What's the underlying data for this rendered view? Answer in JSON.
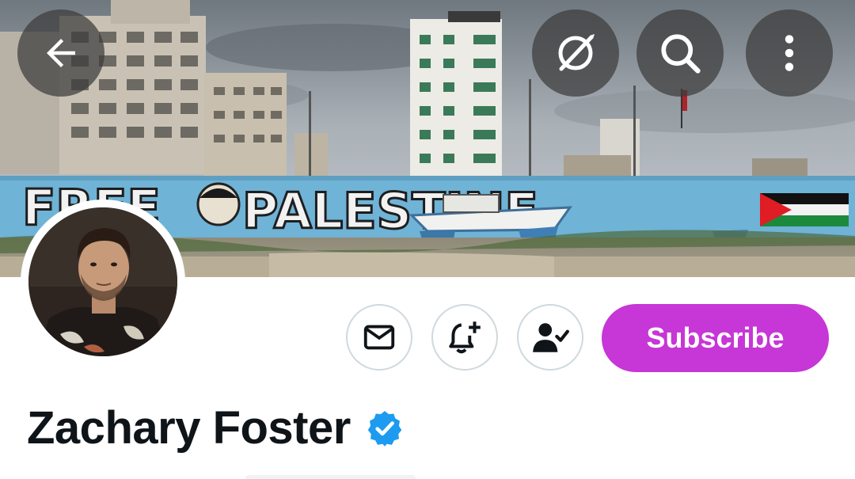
{
  "profile": {
    "display_name": "Zachary Foster",
    "verified": true,
    "verified_color": "#1d9bf0"
  },
  "banner": {
    "mural_text": "FREE PALESTINE",
    "flag_colors": [
      "#000000",
      "#ffffff",
      "#1b8a3c",
      "#e01c24"
    ]
  },
  "header": {
    "back_icon": "arrow-left-icon",
    "grok_icon": "grok-icon",
    "search_icon": "search-icon",
    "more_icon": "more-vertical-icon"
  },
  "actions": {
    "message_icon": "envelope-icon",
    "notify_icon": "bell-plus-icon",
    "following_icon": "person-check-icon",
    "subscribe_label": "Subscribe",
    "subscribe_color": "#c736d6"
  },
  "colors": {
    "text_primary": "#0f1419",
    "border": "#cfd9de"
  }
}
